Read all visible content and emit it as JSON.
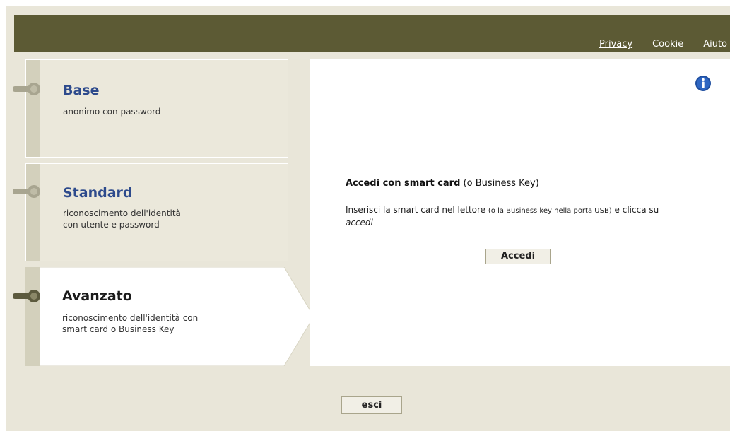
{
  "header": {
    "links": [
      {
        "label": "Privacy"
      },
      {
        "label": "Cookie"
      },
      {
        "label": "Aiuto"
      }
    ]
  },
  "options": [
    {
      "title": "Base",
      "desc_line1": "anonimo con password",
      "desc_line2": ""
    },
    {
      "title": "Standard",
      "desc_line1": "riconoscimento dell'identità",
      "desc_line2": "con utente e password"
    },
    {
      "title": "Avanzato",
      "desc_line1": "riconoscimento dell'identità con",
      "desc_line2": "smart card o Business Key",
      "selected": true
    }
  ],
  "panel": {
    "heading_bold": "Accedi con smart card",
    "heading_rest": " (o Business Key)",
    "body_part1": "Inserisci la smart card nel lettore ",
    "body_small": "(o la Business key nella porta USB)",
    "body_part2": " e clicca su ",
    "body_italic": "accedi",
    "accedi_label": "Accedi"
  },
  "footer": {
    "esci_label": "esci"
  },
  "colors": {
    "topbar": "#5c5a34",
    "background": "#e9e6d9",
    "title_blue": "#2d4a8c",
    "info_blue": "#1f4fa0"
  },
  "icons": {
    "info": "info-icon",
    "key": "key-icon"
  }
}
